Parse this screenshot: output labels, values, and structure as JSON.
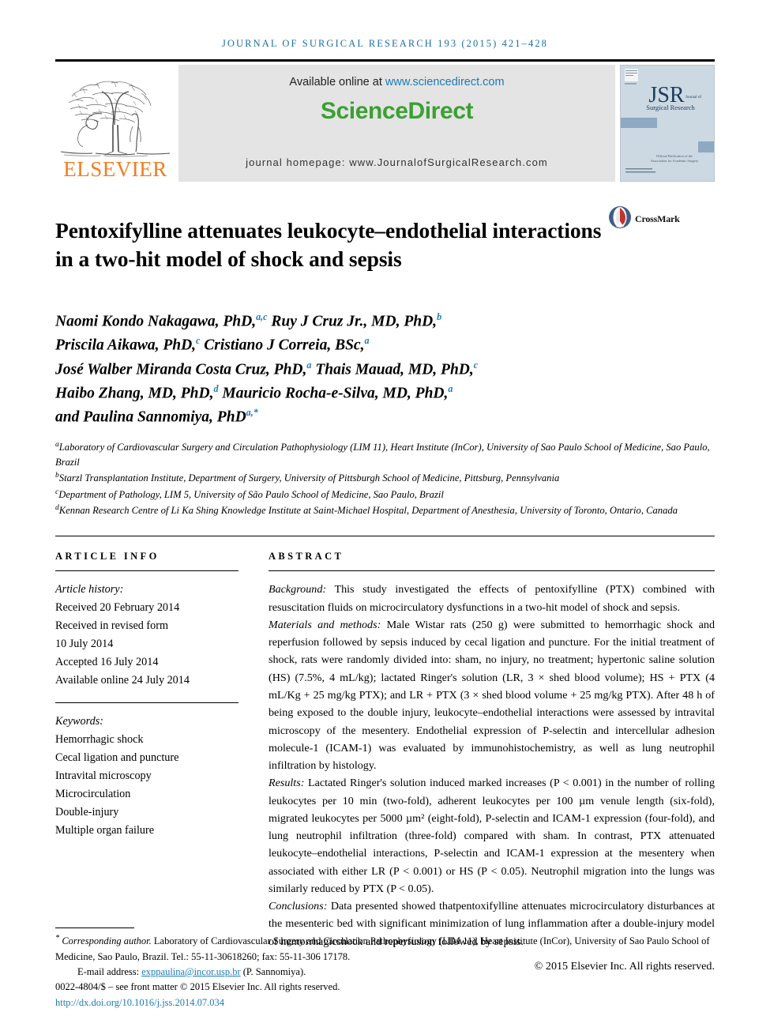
{
  "running_head": "JOURNAL OF SURGICAL RESEARCH 193 (2015) 421–428",
  "masthead": {
    "elsevier_wordmark": "ELSEVIER",
    "available_prefix": "Available online at ",
    "available_url": "www.sciencedirect.com",
    "sciencedirect_logo": "ScienceDirect",
    "homepage_line": "journal homepage: www.JournalofSurgicalResearch.com",
    "cover_title": "JSR",
    "cover_subtitle": "Journal of",
    "cover_subtitle2": "Surgical Research",
    "cover_footer": "Official Publication of the Association for Academic Surgery"
  },
  "crossmark": {
    "label": "CrossMark"
  },
  "title": "Pentoxifylline attenuates leukocyte–endothelial interactions in a two-hit model of shock and sepsis",
  "authors_lines": [
    {
      "text": "Naomi Kondo Nakagawa, PhD,",
      "sup": "a,c",
      "text2": " Ruy J Cruz Jr., MD, PhD,",
      "sup2": "b"
    },
    {
      "text": "Priscila Aikawa, PhD,",
      "sup": "c",
      "text2": " Cristiano J Correia, BSc,",
      "sup2": "a"
    },
    {
      "text": "José Walber Miranda Costa Cruz, PhD,",
      "sup": "a",
      "text2": " Thais Mauad, MD, PhD,",
      "sup2": "c"
    },
    {
      "text": "Haibo Zhang, MD, PhD,",
      "sup": "d",
      "text2": " Mauricio Rocha-e-Silva, MD, PhD,",
      "sup2": "a"
    },
    {
      "text": "and Paulina Sannomiya, PhD",
      "sup": "a,*",
      "text2": "",
      "sup2": ""
    }
  ],
  "affiliations": [
    {
      "marker": "a",
      "text": "Laboratory of Cardiovascular Surgery and Circulation Pathophysiology (LIM 11), Heart Institute (InCor), University of Sao Paulo School of Medicine, Sao Paulo, Brazil"
    },
    {
      "marker": "b",
      "text": "Starzl Transplantation Institute, Department of Surgery, University of Pittsburgh School of Medicine, Pittsburg, Pennsylvania"
    },
    {
      "marker": "c",
      "text": "Department of Pathology, LIM 5, University of São Paulo School of Medicine, Sao Paulo, Brazil"
    },
    {
      "marker": "d",
      "text": "Kennan Research Centre of Li Ka Shing Knowledge Institute at Saint-Michael Hospital, Department of Anesthesia, University of Toronto, Ontario, Canada"
    }
  ],
  "article_info": {
    "heading": "ARTICLE INFO",
    "history_label": "Article history:",
    "history": [
      "Received 20 February 2014",
      "Received in revised form",
      "10 July 2014",
      "Accepted 16 July 2014",
      "Available online 24 July 2014"
    ],
    "keywords_label": "Keywords:",
    "keywords": [
      "Hemorrhagic shock",
      "Cecal ligation and puncture",
      "Intravital microscopy",
      "Microcirculation",
      "Double-injury",
      "Multiple organ failure"
    ]
  },
  "abstract": {
    "heading": "ABSTRACT",
    "sections": [
      {
        "label": "Background:",
        "text": " This study investigated the effects of pentoxifylline (PTX) combined with resuscitation fluids on microcirculatory dysfunctions in a two-hit model of shock and sepsis."
      },
      {
        "label": "Materials and methods:",
        "text": " Male Wistar rats (250 g) were submitted to hemorrhagic shock and reperfusion followed by sepsis induced by cecal ligation and puncture. For the initial treatment of shock, rats were randomly divided into: sham, no injury, no treatment; hypertonic saline solution (HS) (7.5%, 4 mL/kg); lactated Ringer's solution (LR, 3 × shed blood volume); HS + PTX (4 mL/Kg + 25 mg/kg PTX); and LR + PTX (3 × shed blood volume + 25 mg/kg PTX). After 48 h of being exposed to the double injury, leukocyte–endothelial interactions were assessed by intravital microscopy of the mesentery. Endothelial expression of P-selectin and intercellular adhesion molecule-1 (ICAM-1) was evaluated by immunohistochemistry, as well as lung neutrophil infiltration by histology."
      },
      {
        "label": "Results:",
        "text": " Lactated Ringer's solution induced marked increases (P < 0.001) in the number of rolling leukocytes per 10 min (two-fold), adherent leukocytes per 100 µm venule length (six-fold), migrated leukocytes per 5000 µm² (eight-fold), P-selectin and ICAM-1 expression (four-fold), and lung neutrophil infiltration (three-fold) compared with sham. In contrast, PTX attenuated leukocyte–endothelial interactions, P-selectin and ICAM-1 expression at the mesentery when associated with either LR (P < 0.001) or HS (P < 0.05). Neutrophil migration into the lungs was similarly reduced by PTX (P < 0.05)."
      },
      {
        "label": "Conclusions:",
        "text": " Data presented showed thatpentoxifylline attenuates microcirculatory disturbances at the mesenteric bed with significant minimization of lung inflammation after a double-injury model of hemorrhagicshock and reperfusion followed by sepsis."
      }
    ],
    "copyright": "© 2015 Elsevier Inc. All rights reserved."
  },
  "footer": {
    "corresponding_marker": "*",
    "corresponding_text": "Corresponding author.",
    "corresponding_address": " Laboratory of Cardiovascular Surgery and Circulation Pathophysiology (LIM 11), Heart Institute (InCor), University of Sao Paulo School of Medicine, Sao Paulo, Brazil. Tel.: 55-11-30618260; fax: 55-11-306 17178.",
    "email_label": "E-mail address: ",
    "email": "exppaulina@incor.usp.br",
    "email_suffix": " (P. Sannomiya).",
    "issn_line": "0022-4804/$ – see front matter © 2015 Elsevier Inc. All rights reserved.",
    "doi": "http://dx.doi.org/10.1016/j.jss.2014.07.034"
  },
  "colors": {
    "journal_blue": "#1c6ea4",
    "link_blue": "#1c7bb5",
    "elsevier_orange": "#f07d22",
    "sciencedirect_green": "#3aa033",
    "banner_gray": "#e4e4e4"
  }
}
